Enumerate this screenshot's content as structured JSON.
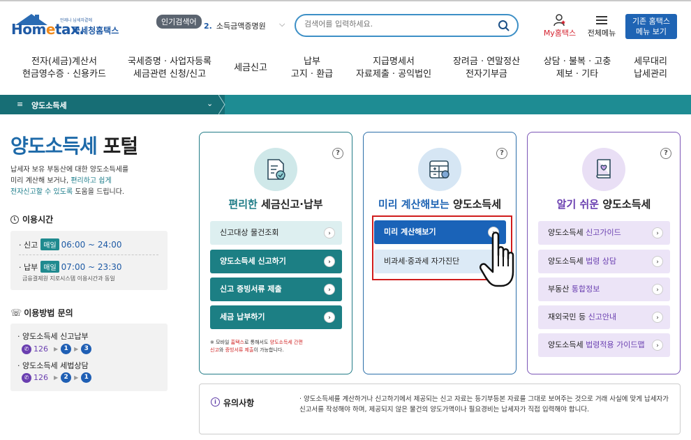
{
  "header": {
    "logo_tiny": "언제나 납세자곁에",
    "logo_brand_a": "Hom",
    "logo_brand_e": "e",
    "logo_brand_b": "tax.",
    "logo_brand_ko": "국세청홈택스",
    "popular_badge": "인기검색어",
    "popular_rank": "2.",
    "popular_term": "소득금액증명원",
    "search_placeholder": "검색어를 입력하세요.",
    "my_hometax": "My홈택스",
    "all_menu": "전체메뉴",
    "old_hometax_btn": "기존 홈택스\n메뉴 보기"
  },
  "gnb": [
    {
      "label": "전자(세금)계산서\n현금영수증 · 신용카드"
    },
    {
      "label": "국세증명 · 사업자등록\n세금관련 신청/신고"
    },
    {
      "label": "세금신고"
    },
    {
      "label": "납부\n고지 · 환급"
    },
    {
      "label": "지급명세서\n자료제출 · 공익법인"
    },
    {
      "label": "장려금 · 연말정산\n전자기부금"
    },
    {
      "label": "상담 · 불복 · 고충\n제보 · 기타"
    },
    {
      "label": "세무대리\n납세관리"
    }
  ],
  "breadcrumb": {
    "label": "양도소득세"
  },
  "left": {
    "title_a": "양도소득세",
    "title_b": " 포털",
    "intro_1": "납세자 보유 부동산에 대한 양도소득세를",
    "intro_2a": "미리 계산해 보거나, ",
    "intro_2b": "편리하고 쉽게",
    "intro_3a": "전자신고할 수 있도록",
    "intro_3b": " 도움을 드립니다.",
    "hours_title": "이용시간",
    "hours": [
      {
        "label": "신고",
        "badge": "매일",
        "time": "06:00 ~ 24:00"
      },
      {
        "label": "납부",
        "badge": "매일",
        "time": "07:00 ~ 23:30"
      }
    ],
    "hours_note": "금융결제원 지로시스템 이용시간과 동일",
    "contact_title": "이용방법 문의",
    "contacts": [
      {
        "label": "양도소득세 신고납부",
        "phone": "126",
        "steps": [
          "1",
          "3"
        ]
      },
      {
        "label": "양도소득세 세법상담",
        "phone": "126",
        "steps": [
          "2",
          "1"
        ]
      }
    ]
  },
  "cards": {
    "card1": {
      "title_hl": "편리한",
      "title_rest": " 세금신고·납부",
      "buttons": [
        "신고대상 물건조회",
        "양도소득세 신고하기",
        "신고 증빙서류 제출",
        "세금 납부하기"
      ],
      "note_a": "※ 모바일 ",
      "note_b": "홈택스",
      "note_c": "로 통해서도 ",
      "note_d": "양도소득세 간편",
      "note_e": "신고",
      "note_f": "와 ",
      "note_g": "증빙서류 제출",
      "note_h": "이 가능합니다."
    },
    "card2": {
      "title_hl": "미리 계산해보는",
      "title_rest": " 양도소득세",
      "buttons": [
        "미리 계산해보기",
        "비과세·중과세 자가진단"
      ]
    },
    "card3": {
      "title_hl": "알기 쉬운",
      "title_rest": " 양도소득세",
      "buttons": [
        {
          "a": "양도소득세 ",
          "b": "신고가이드"
        },
        {
          "a": "양도소득세 ",
          "b": "법령 상담"
        },
        {
          "a": "부동산 ",
          "b": "통합정보"
        },
        {
          "a": "재외국민 등 ",
          "b": "신고안내"
        },
        {
          "a": "양도소득세 ",
          "b": "법령적용 가이드맵"
        }
      ]
    },
    "help": "?"
  },
  "notice": {
    "title": "유의사항",
    "body": "· 양도소득세를 계산하거나 신고하기에서 제공되는 신고 자료는 등기부등본 자료를 그대로 보여주는 것으로 거래 사실에 맞게 납세자가 신고서를 작성해야 하며, 제공되지 않은 물건의 양도가액이나 필요경비는 납세자가 직접 입력해야 합니다."
  },
  "colors": {
    "teal": "#1c7f84",
    "blue": "#1a63b8",
    "purple": "#6a3fb0",
    "highlight_red": "#d01c1c"
  },
  "icons": [
    "search-icon",
    "my-hometax-icon",
    "menu-icon",
    "clock-icon",
    "phone-icon",
    "help-icon",
    "arrow-right-icon",
    "hand-cursor-icon",
    "info-icon"
  ]
}
